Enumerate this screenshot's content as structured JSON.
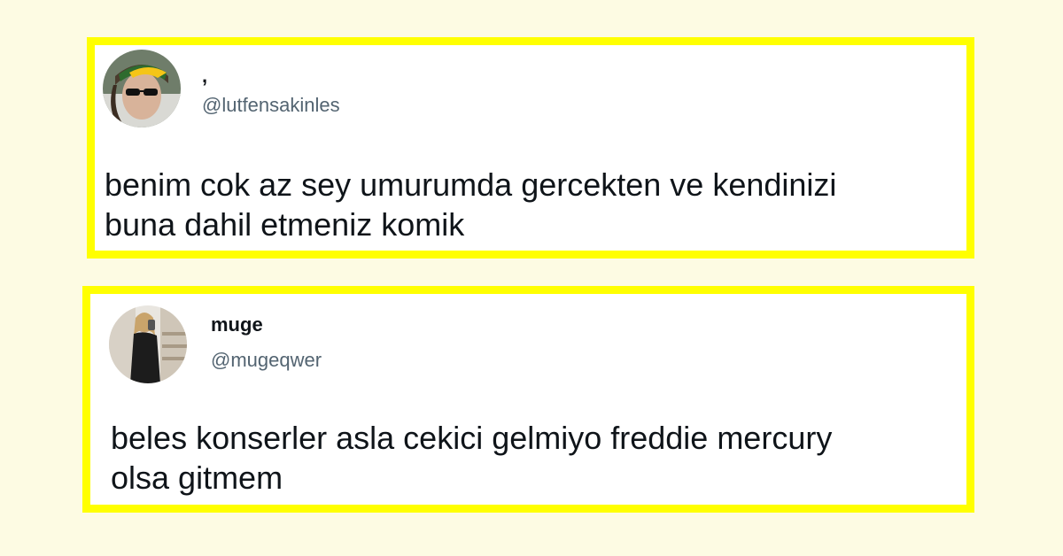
{
  "tweets": [
    {
      "display_name": ",",
      "handle": "@lutfensakinles",
      "text_lines": [
        "benim cok az sey umurumda gercekten ve kendinizi",
        "buna dahil etmeniz komik"
      ]
    },
    {
      "display_name": "muge",
      "handle": "@mugeqwer",
      "text_lines": [
        "beles konserler asla cekici gelmiyo freddie mercury",
        "olsa gitmem"
      ]
    }
  ],
  "colors": {
    "page_background": "#fdfbe3",
    "card_border": "#ffff00",
    "text_primary": "#0f1419",
    "text_secondary": "#536471"
  }
}
